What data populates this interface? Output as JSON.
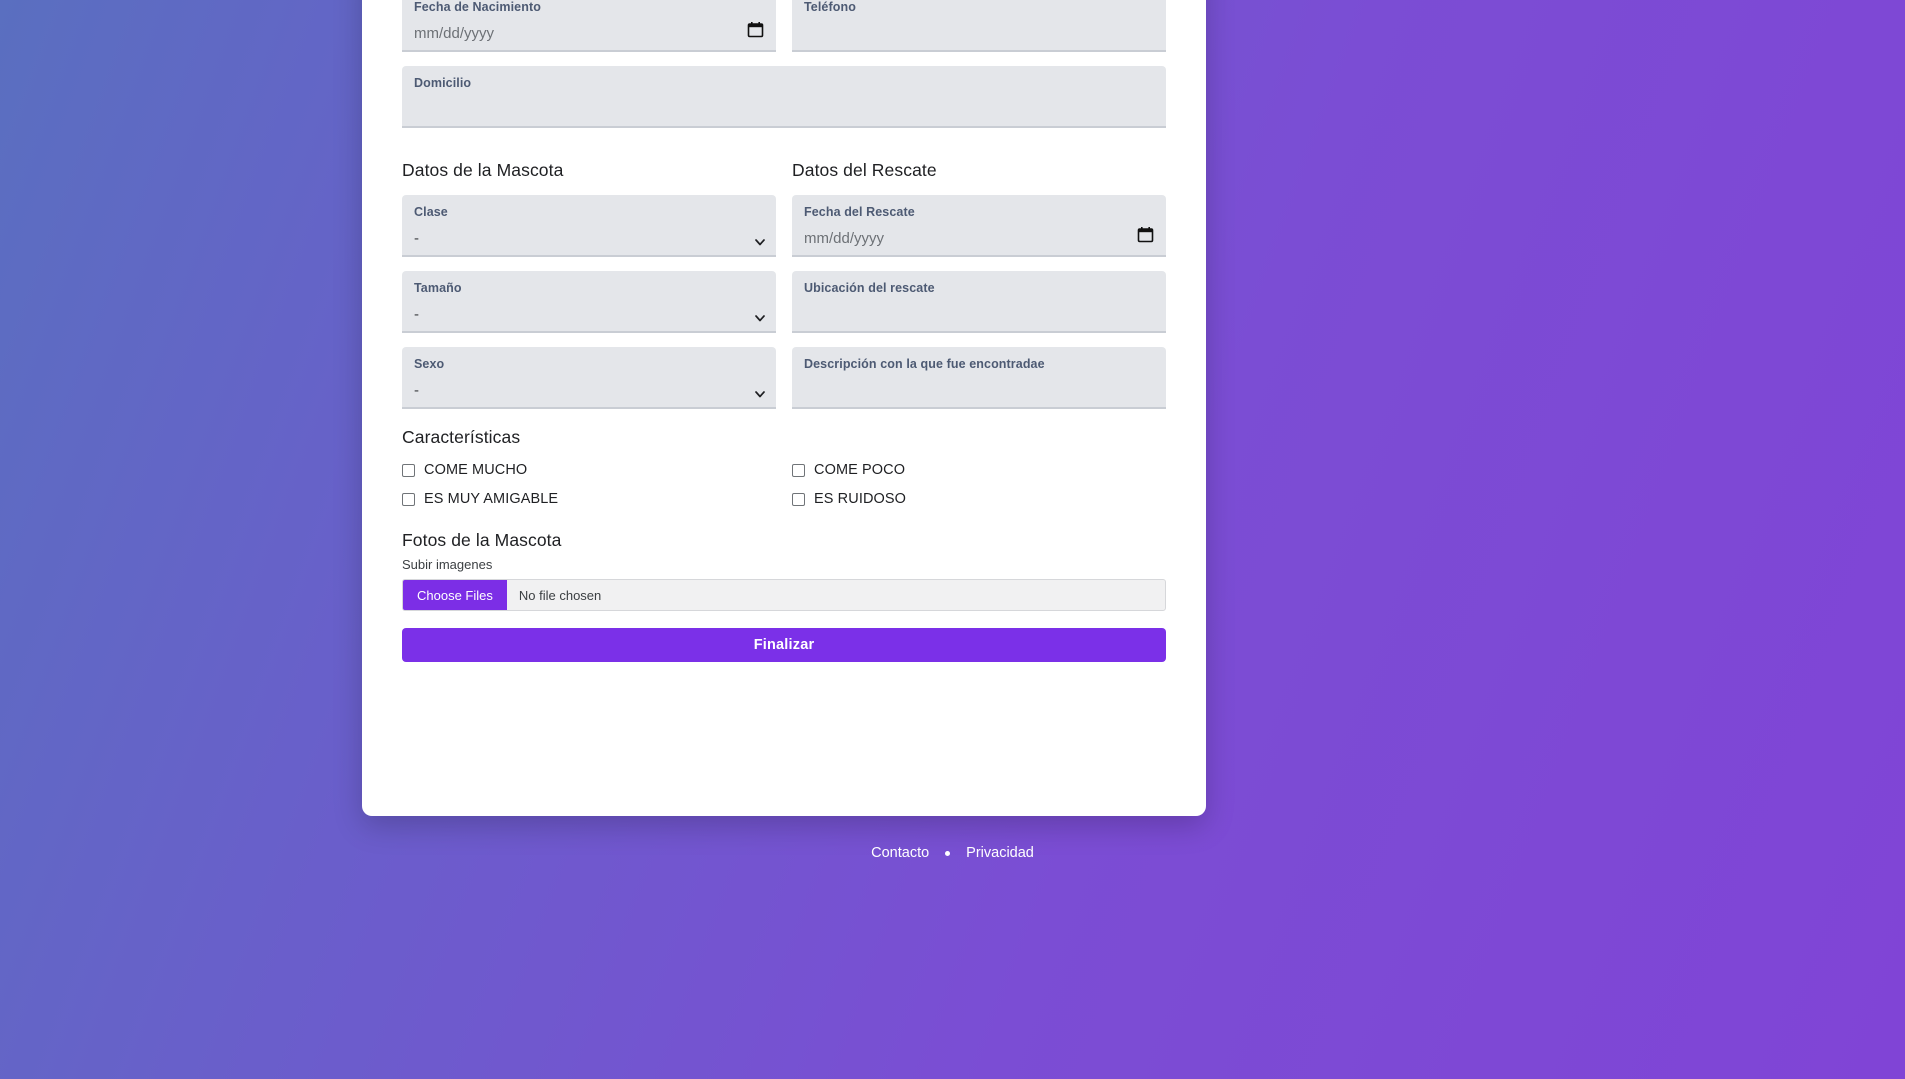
{
  "personal": {
    "fields": [
      {
        "label": "Fecha de Nacimiento",
        "value": "mm/dd/yyyy",
        "type": "date",
        "icon": "calendar-icon"
      },
      {
        "label": "Teléfono",
        "value": "",
        "type": "text"
      },
      {
        "label": "Domicilio",
        "value": "",
        "type": "text"
      }
    ]
  },
  "sections": {
    "mascota_title": "Datos de la Mascota",
    "rescate_title": "Datos del Rescate",
    "caracteristicas_title": "Características",
    "fotos_title": "Fotos de la Mascota"
  },
  "mascota": {
    "fields": [
      {
        "label": "Clase",
        "value": "-",
        "type": "select",
        "icon": "chevron-down-icon"
      },
      {
        "label": "Tamaño",
        "value": "-",
        "type": "select",
        "icon": "chevron-down-icon"
      },
      {
        "label": "Sexo",
        "value": "-",
        "type": "select",
        "icon": "chevron-down-icon"
      }
    ]
  },
  "rescate": {
    "fields": [
      {
        "label": "Fecha del Rescate",
        "value": "mm/dd/yyyy",
        "type": "date",
        "icon": "calendar-icon"
      },
      {
        "label": "Ubicación del rescate",
        "value": "",
        "type": "text"
      },
      {
        "label": "Descripción con la que fue encontradae",
        "value": "",
        "type": "text"
      }
    ]
  },
  "caracteristicas": {
    "left": [
      {
        "label": "COME MUCHO",
        "checked": false
      },
      {
        "label": "ES MUY AMIGABLE",
        "checked": false
      }
    ],
    "right": [
      {
        "label": "COME POCO",
        "checked": false
      },
      {
        "label": "ES RUIDOSO",
        "checked": false
      }
    ]
  },
  "fotos": {
    "upload_label": "Subir imagenes",
    "choose_button": "Choose Files",
    "no_file_text": "No file chosen"
  },
  "submit": {
    "label": "Finalizar"
  },
  "footer": {
    "contacto": "Contacto",
    "privacidad": "Privacidad",
    "separator": "•"
  },
  "colors": {
    "accent_purple": "#7b30e8",
    "file_button": "#7c2ee6",
    "field_bg": "#e4e6ea",
    "field_underline": "#c9cdd4",
    "label_text": "#4d5a73",
    "bg_gradient_start": "#5a6fc0",
    "bg_gradient_end": "#8044d6"
  }
}
